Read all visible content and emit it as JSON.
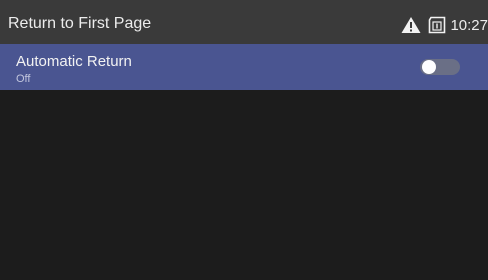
{
  "title_bar": {
    "title": "Return to First Page",
    "time": "10:27",
    "icons": [
      "warning-icon",
      "sim-card-icon"
    ]
  },
  "setting": {
    "label": "Automatic Return",
    "state_text": "Off",
    "toggle_on": false
  },
  "colors": {
    "title_bar_bg": "#3a3a3a",
    "highlight_row_bg": "#4a5591",
    "background": "#1c1c1c"
  }
}
